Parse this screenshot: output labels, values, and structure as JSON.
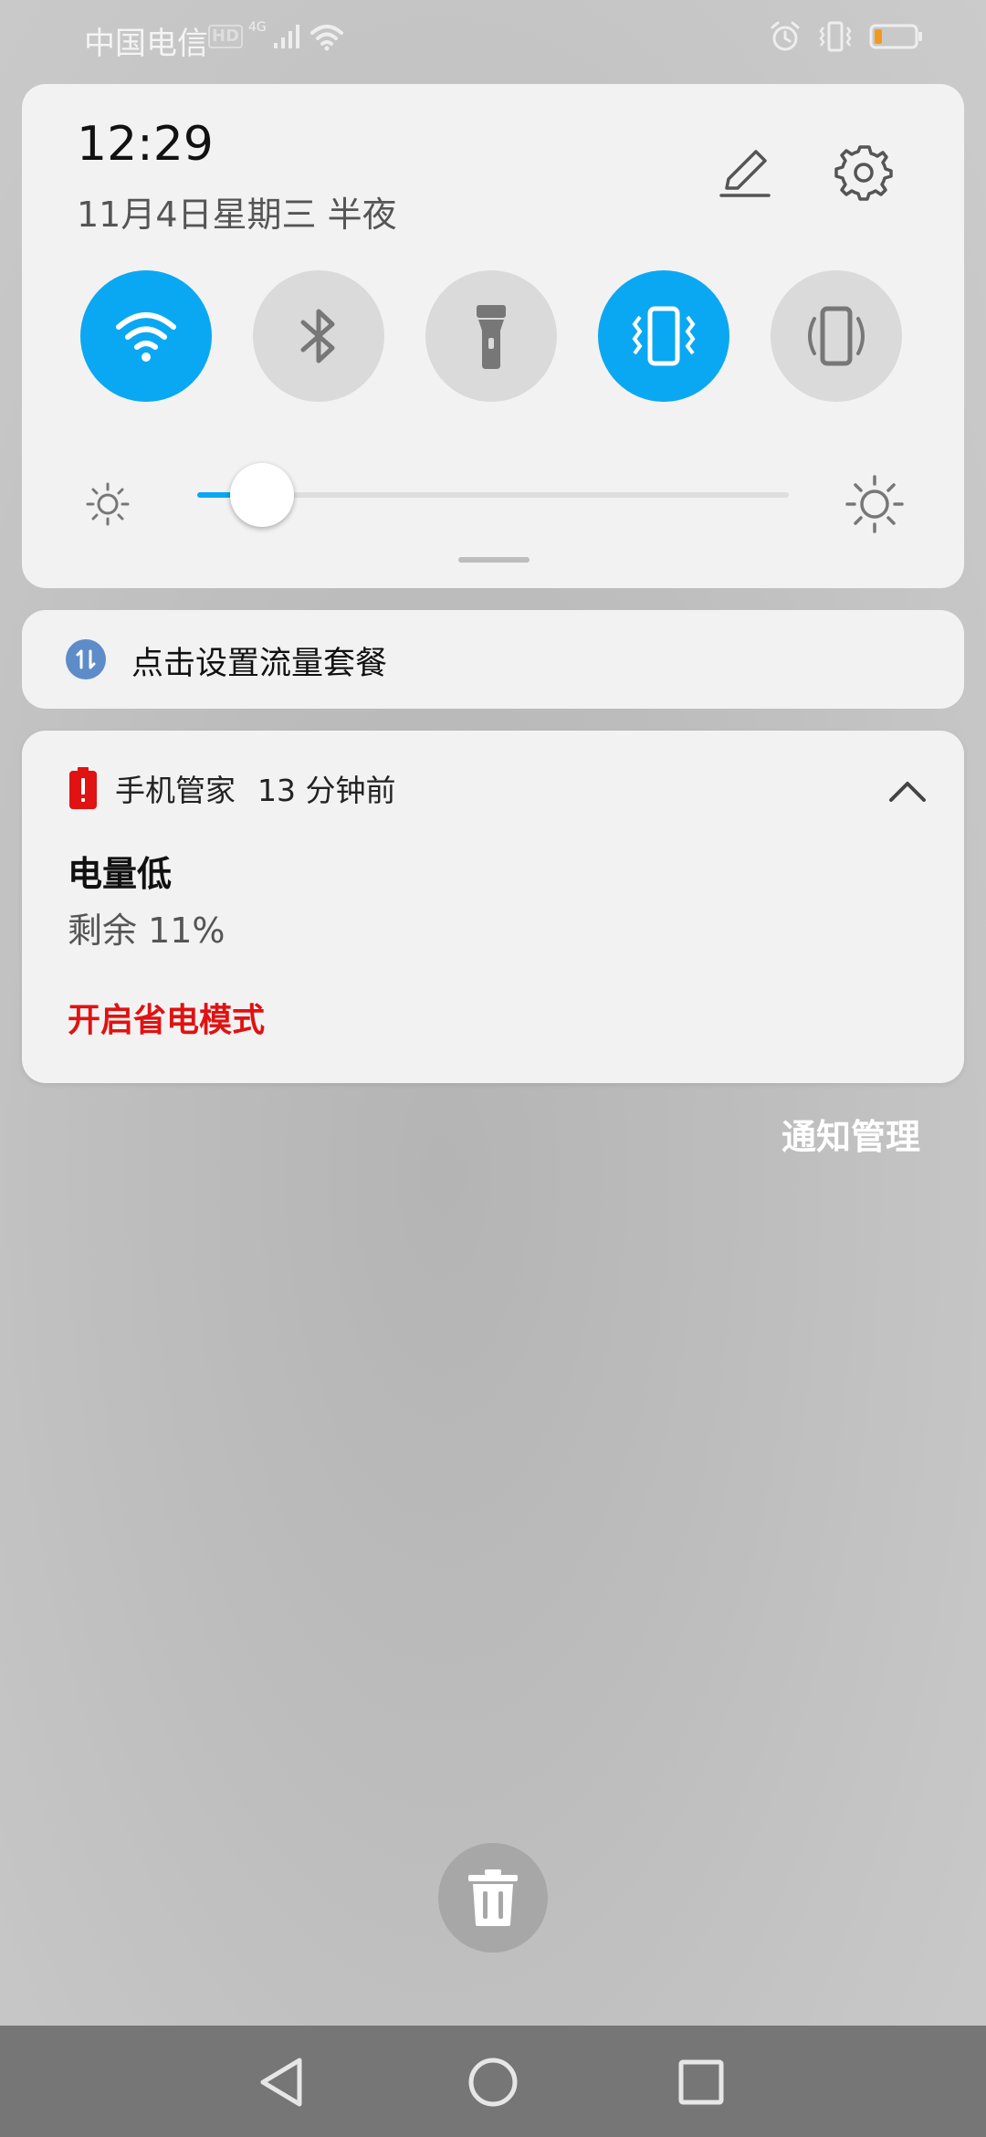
{
  "status_bar": {
    "carrier": "中国电信",
    "hd_badge": "HD",
    "network_type": "4G",
    "battery_level": 0.11,
    "icons": [
      "signal-icon",
      "wifi-icon",
      "alarm-icon",
      "vibrate-icon",
      "battery-icon"
    ]
  },
  "quick_settings": {
    "time": "12:29",
    "date": "11月4日星期三 半夜",
    "toggles": [
      {
        "name": "wifi",
        "icon": "wifi-icon",
        "on": true
      },
      {
        "name": "bluetooth",
        "icon": "bluetooth-icon",
        "on": false
      },
      {
        "name": "flashlight",
        "icon": "flashlight-icon",
        "on": false
      },
      {
        "name": "vibrate",
        "icon": "vibrate-icon",
        "on": true
      },
      {
        "name": "auto-rotate",
        "icon": "rotate-icon",
        "on": false
      }
    ],
    "brightness_level": 0.1,
    "accent_color": "#0aa8f2"
  },
  "data_plan": {
    "text": "点击设置流量套餐"
  },
  "notification": {
    "app_name": "手机管家",
    "time_ago": "13 分钟前",
    "title": "电量低",
    "body": "剩余 11%",
    "action": "开启省电模式",
    "action_color": "#e01212"
  },
  "notification_manage": "通知管理",
  "nav": {
    "buttons": [
      "back-icon",
      "home-icon",
      "recents-icon"
    ]
  }
}
